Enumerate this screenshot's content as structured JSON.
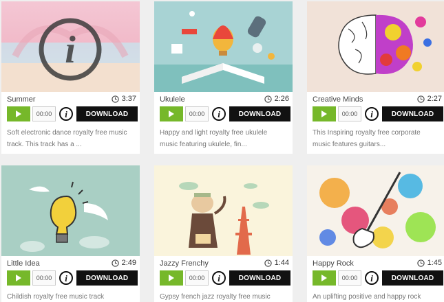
{
  "cards": [
    {
      "title": "Summer",
      "duration": "3:37",
      "time": "00:00",
      "download": "DOWNLOAD",
      "desc_line1": "Soft electronic dance royalty free music",
      "desc_line2": "track. This track has a ..."
    },
    {
      "title": "Ukulele",
      "duration": "2:26",
      "time": "00:00",
      "download": "DOWNLOAD",
      "desc_line1": "Happy and light royalty free ukulele",
      "desc_line2": "music featuring ukulele, fin..."
    },
    {
      "title": "Creative Minds",
      "duration": "2:27",
      "time": "00:00",
      "download": "DOWNLOAD",
      "desc_line1": "This Inspiring royalty free corporate",
      "desc_line2": "music features guitars..."
    },
    {
      "title": "Little Idea",
      "duration": "2:49",
      "time": "00:00",
      "download": "DOWNLOAD",
      "desc_line1": "Childish royalty free music track",
      "desc_line2": ""
    },
    {
      "title": "Jazzy Frenchy",
      "duration": "1:44",
      "time": "00:00",
      "download": "DOWNLOAD",
      "desc_line1": "Gypsy french jazz royalty free music",
      "desc_line2": ""
    },
    {
      "title": "Happy Rock",
      "duration": "1:45",
      "time": "00:00",
      "download": "DOWNLOAD",
      "desc_line1": "An uplifting positive and happy rock",
      "desc_line2": ""
    }
  ],
  "icons": {
    "clock": "clock-icon",
    "info": "info-icon",
    "play": "play-icon"
  },
  "colors": {
    "play_green": "#76b82a",
    "download_black": "#111111"
  }
}
